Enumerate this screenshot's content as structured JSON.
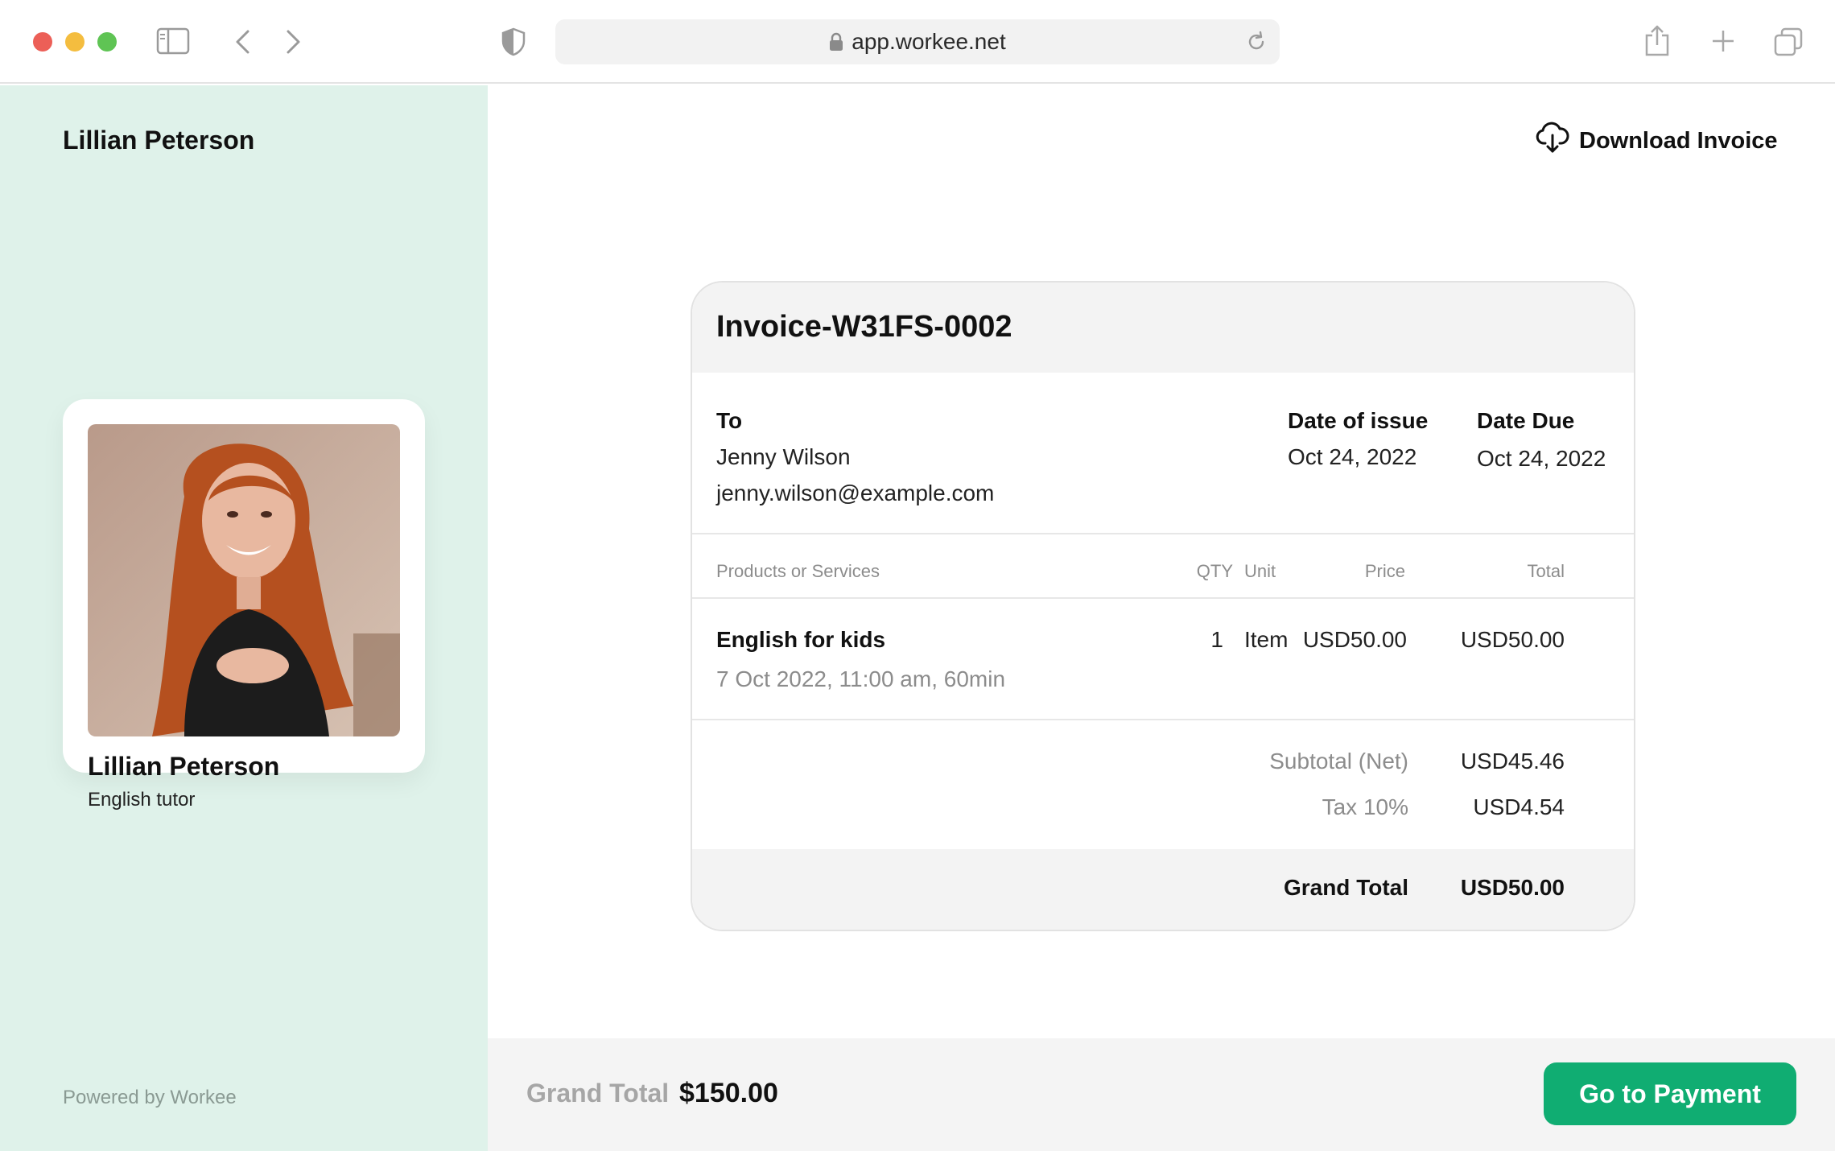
{
  "browser": {
    "url": "app.workee.net"
  },
  "sidebar": {
    "owner_name": "Lillian Peterson",
    "profile": {
      "name": "Lillian Peterson",
      "role": "English tutor"
    },
    "powered_by": "Powered by Workee"
  },
  "header": {
    "download_label": "Download Invoice"
  },
  "invoice": {
    "title": "Invoice-W31FS-0002",
    "to_label": "To",
    "recipient_name": "Jenny Wilson",
    "recipient_email": "jenny.wilson@example.com",
    "issue_label": "Date of issue",
    "issue_date": "Oct 24, 2022",
    "due_label": "Date Due",
    "due_date": "Oct 24, 2022",
    "columns": {
      "product": "Products or Services",
      "qty": "QTY",
      "unit": "Unit",
      "price": "Price",
      "total": "Total"
    },
    "items": [
      {
        "name": "English for kids",
        "detail": "7 Oct 2022, 11:00 am, 60min",
        "qty": "1",
        "unit": "Item",
        "price": "USD50.00",
        "total": "USD50.00"
      }
    ],
    "subtotal_label": "Subtotal (Net)",
    "subtotal_value": "USD45.46",
    "tax_label": "Tax 10%",
    "tax_value": "USD4.54",
    "grand_total_label": "Grand Total",
    "grand_total_value": "USD50.00"
  },
  "footer": {
    "grand_total_label": "Grand Total",
    "grand_total_value": "$150.00",
    "pay_button": "Go to Payment"
  },
  "colors": {
    "sidebar_bg": "#dff2ea",
    "primary_button": "#10ad72"
  }
}
